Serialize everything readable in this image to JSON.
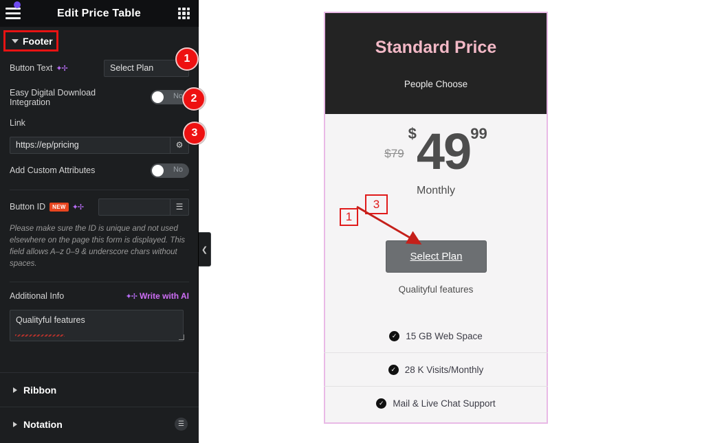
{
  "panel": {
    "title": "Edit Price Table",
    "menu_icon": "hamburger-icon",
    "grid_icon": "grid-apps-icon",
    "section_footer": "Footer",
    "fields": {
      "button_text_label": "Button Text",
      "button_text_value": "Select Plan",
      "edd_label": "Easy Digital Download Integration",
      "edd_toggle": "No",
      "link_label": "Link",
      "link_value": "https://ep/pricing",
      "link_settings_icon": "gear-icon",
      "custom_attr_label": "Add Custom Attributes",
      "custom_attr_toggle": "No",
      "button_id_label": "Button ID",
      "button_id_badge": "NEW",
      "button_id_value": "",
      "button_id_icon": "database-icon",
      "button_id_helper": "Please make sure the ID is unique and not used elsewhere on the page this form is displayed. This field allows A–z  0–9 & underscore chars without spaces.",
      "additional_info_label": "Additional Info",
      "write_with_ai": "Write with AI",
      "additional_info_value": "Qualityful features"
    },
    "sections": [
      {
        "label": "Ribbon"
      },
      {
        "label": "Notation",
        "icon": "note-icon"
      }
    ],
    "badges": [
      "1",
      "2",
      "3"
    ],
    "collapse_icon": "chevron-left-icon"
  },
  "card": {
    "title": "Standard Price",
    "subtitle": "People Choose",
    "old_price": "$79",
    "currency": "$",
    "amount": "49",
    "cents": "99",
    "period": "Monthly",
    "cta_label": "Select Plan",
    "extra_info": "Qualityful features",
    "features": [
      {
        "icon": "check-circle-icon",
        "label": "15 GB Web Space"
      },
      {
        "icon": "check-circle-icon",
        "label": "28 K Visits/Monthly"
      },
      {
        "icon": "check-circle-icon",
        "label": "Mail & Live Chat Support"
      }
    ]
  },
  "annotations": {
    "box1": "1",
    "box3": "3"
  },
  "colors": {
    "accent_red": "#ee1111",
    "panel_bg": "#1c1e20",
    "card_border": "#e9b9e6",
    "card_header_bg": "#232323",
    "card_title": "#f2b8c6",
    "ai_purple": "#cf6ef7",
    "badge_new": "#e8451f"
  }
}
